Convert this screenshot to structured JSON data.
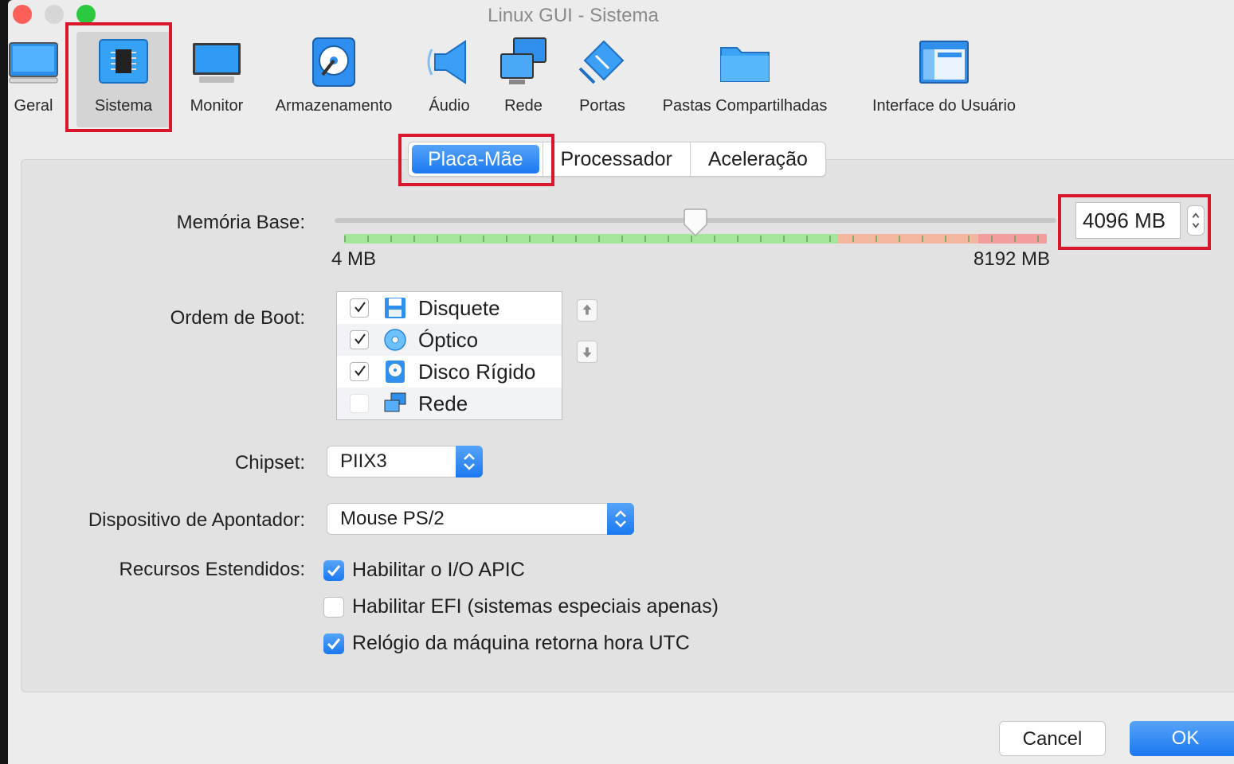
{
  "window": {
    "title": "Linux GUI - Sistema"
  },
  "toolbar": {
    "items": [
      {
        "label": "Geral",
        "icon": "general-icon"
      },
      {
        "label": "Sistema",
        "icon": "chip-icon",
        "selected": true
      },
      {
        "label": "Monitor",
        "icon": "monitor-icon"
      },
      {
        "label": "Armazenamento",
        "icon": "storage-icon"
      },
      {
        "label": "Áudio",
        "icon": "speaker-icon"
      },
      {
        "label": "Rede",
        "icon": "network-icon"
      },
      {
        "label": "Portas",
        "icon": "ports-icon"
      },
      {
        "label": "Pastas Compartilhadas",
        "icon": "folder-icon"
      },
      {
        "label": "Interface do Usuário",
        "icon": "ui-window-icon"
      }
    ]
  },
  "tabs": [
    {
      "label": "Placa-Mãe",
      "active": true
    },
    {
      "label": "Processador"
    },
    {
      "label": "Aceleração"
    }
  ],
  "memory": {
    "label": "Memória Base:",
    "min_label": "4 MB",
    "max_label": "8192 MB",
    "value": "4096 MB",
    "value_mb": 4096,
    "min_mb": 4,
    "max_mb": 8192
  },
  "boot": {
    "label": "Ordem de Boot:",
    "items": [
      {
        "label": "Disquete",
        "checked": true,
        "icon": "floppy-icon"
      },
      {
        "label": "Óptico",
        "checked": true,
        "icon": "optical-disc-icon"
      },
      {
        "label": "Disco Rígido",
        "checked": true,
        "icon": "hard-disk-icon"
      },
      {
        "label": "Rede",
        "checked": false,
        "icon": "network-icon"
      }
    ]
  },
  "chipset": {
    "label": "Chipset:",
    "value": "PIIX3"
  },
  "pointer": {
    "label": "Dispositivo de Apontador:",
    "value": "Mouse PS/2"
  },
  "extended": {
    "label": "Recursos Estendidos:",
    "options": [
      {
        "label": "Habilitar o I/O APIC",
        "checked": true
      },
      {
        "label": "Habilitar EFI (sistemas especiais apenas)",
        "checked": false
      },
      {
        "label": "Relógio da máquina retorna hora UTC",
        "checked": true
      }
    ]
  },
  "buttons": {
    "cancel": "Cancel",
    "ok": "OK"
  },
  "colors": {
    "accent": "#1a78f0",
    "highlight": "#d8182a"
  }
}
